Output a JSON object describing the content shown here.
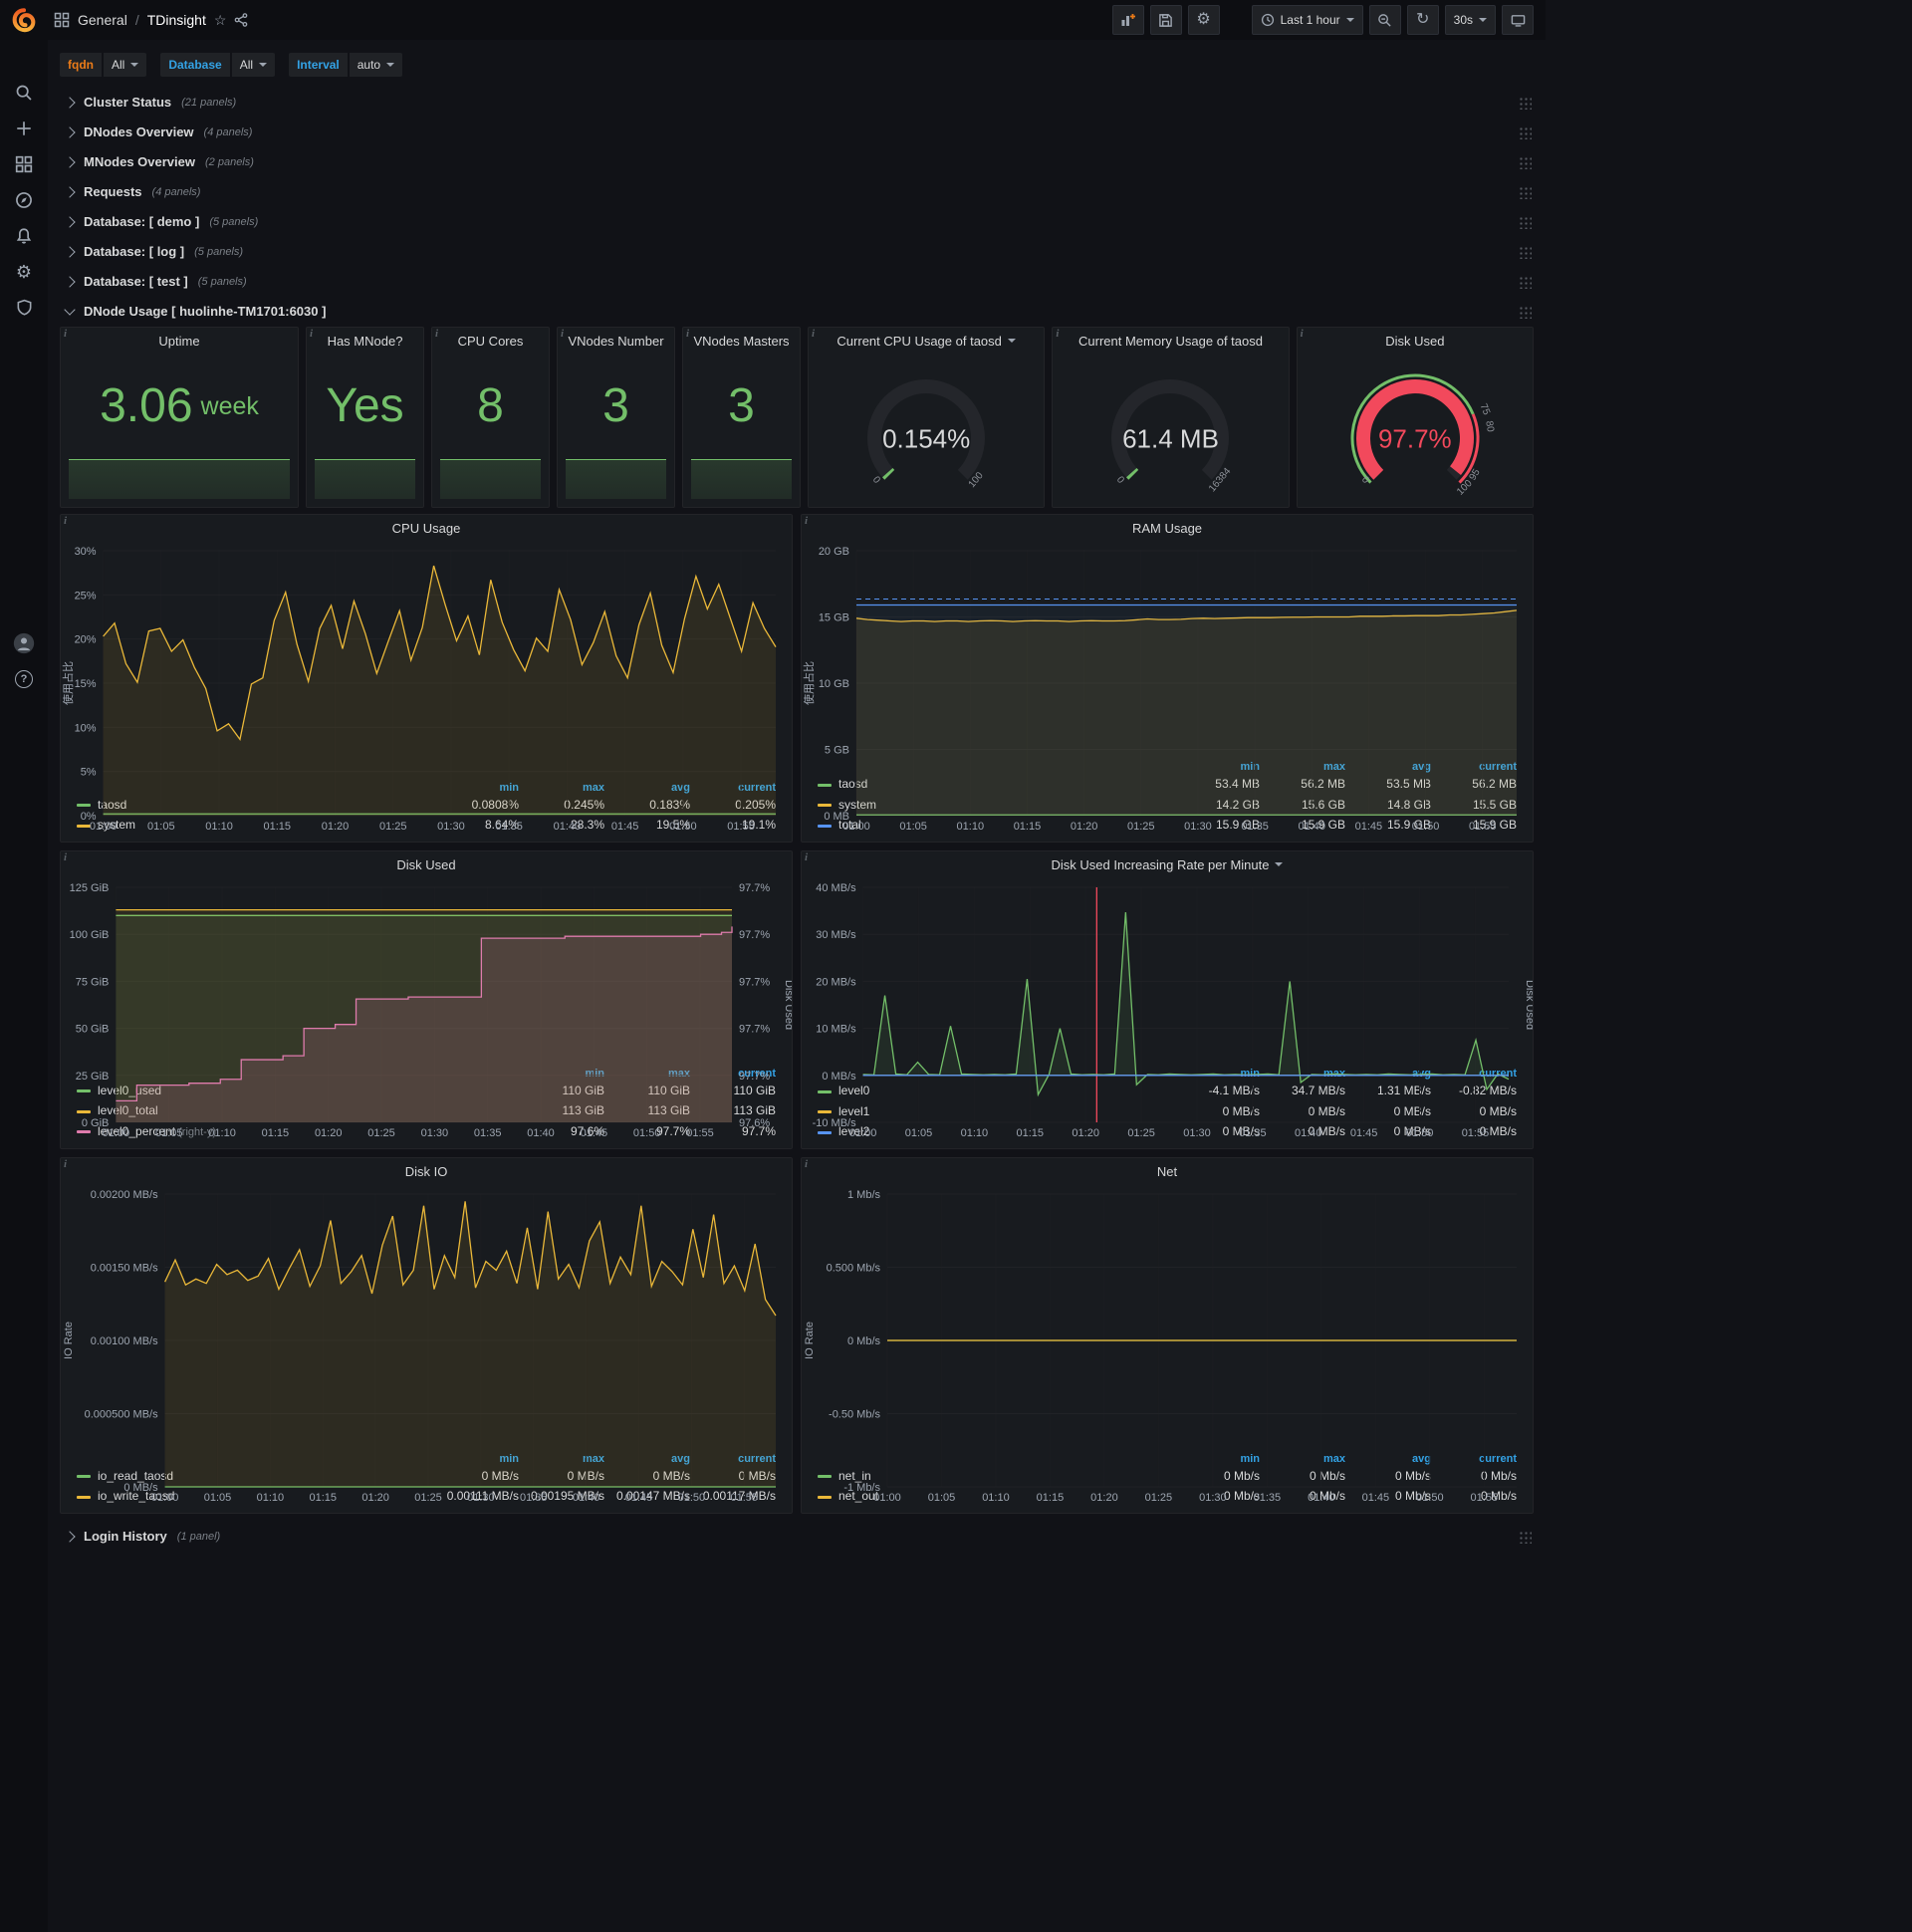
{
  "topnav": {
    "section": "General",
    "separator": "/",
    "page": "TDinsight",
    "time_range": "Last 1 hour",
    "refresh_interval": "30s"
  },
  "icons": {
    "gear": "⚙",
    "refresh": "↻",
    "star": "☆",
    "question": "?",
    "plus": "+"
  },
  "variables": [
    {
      "label": "fqdn",
      "value": "All",
      "label_color": "#eb7b18"
    },
    {
      "label": "Database",
      "value": "All",
      "label_color": "#33a2e5"
    },
    {
      "label": "Interval",
      "value": "auto",
      "label_color": "#33a2e5"
    }
  ],
  "collapsed_rows": [
    {
      "title": "Cluster Status",
      "count": "(21 panels)"
    },
    {
      "title": "DNodes Overview",
      "count": "(4 panels)"
    },
    {
      "title": "MNodes Overview",
      "count": "(2 panels)"
    },
    {
      "title": "Requests",
      "count": "(4 panels)"
    },
    {
      "title": "Database: [ demo ]",
      "count": "(5 panels)"
    },
    {
      "title": "Database: [ log ]",
      "count": "(5 panels)"
    },
    {
      "title": "Database: [ test ]",
      "count": "(5 panels)"
    }
  ],
  "expanded_row": {
    "title": "DNode Usage [ huolinhe-TM1701:6030 ]"
  },
  "bottom_row": {
    "title": "Login History",
    "count": "(1 panel)"
  },
  "stats": [
    {
      "title": "Uptime",
      "value": "3.06",
      "unit": "week"
    },
    {
      "title": "Has MNode?",
      "value": "Yes"
    },
    {
      "title": "CPU Cores",
      "value": "8"
    },
    {
      "title": "VNodes Number",
      "value": "3"
    },
    {
      "title": "VNodes Masters",
      "value": "3"
    }
  ],
  "gauges": [
    {
      "title": "Current CPU Usage of taosd",
      "value": "0.154%",
      "min": "0",
      "max": "100",
      "fraction": 0.00154,
      "arc_color": "#73bf69",
      "value_color": "#d8d9da",
      "has_dropdown": true
    },
    {
      "title": "Current Memory Usage of taosd",
      "value": "61.4 MB",
      "min": "0",
      "max": "16384",
      "fraction": 0.00375,
      "arc_color": "#73bf69",
      "value_color": "#d8d9da"
    },
    {
      "title": "Disk Used",
      "value": "97.7%",
      "min": "0",
      "max": "100",
      "fraction": 0.977,
      "arc_color": "#f2495c",
      "value_color": "#f2495c",
      "thresholds": [
        {
          "label": "75",
          "value": 75
        },
        {
          "label": "80",
          "value": 80
        },
        {
          "label": "95",
          "value": 95
        },
        {
          "label": "100",
          "value": 100
        }
      ],
      "ring": [
        {
          "from": 0,
          "to": 0.75,
          "color": "#73bf69"
        },
        {
          "from": 0.75,
          "to": 1,
          "color": "#f2495c"
        }
      ]
    }
  ],
  "time_ticks": [
    "01:00",
    "01:05",
    "01:10",
    "01:15",
    "01:20",
    "01:25",
    "01:30",
    "01:35",
    "01:40",
    "01:45",
    "01:50",
    "01:55"
  ],
  "charts": [
    {
      "type": "line",
      "title": "CPU Usage",
      "y_label": "使用占比",
      "y_ticks": [
        "30%",
        "25%",
        "20%",
        "15%",
        "10%",
        "5%",
        "0%"
      ],
      "ymin": 0,
      "ymax": 30,
      "legend_cols": [
        "min",
        "max",
        "avg",
        "current"
      ],
      "series": [
        {
          "name": "taosd",
          "color": "#73bf69",
          "flat": 0.2,
          "n": 60,
          "stats": [
            "0.0808%",
            "0.245%",
            "0.183%",
            "0.205%"
          ]
        },
        {
          "name": "system",
          "color": "#eab839",
          "values": [
            20.3,
            21.8,
            17.2,
            15.1,
            20.9,
            21.2,
            18.6,
            19.9,
            16.8,
            14.4,
            9.6,
            10.4,
            8.64,
            14.9,
            15.6,
            22.1,
            25.3,
            19.4,
            15.2,
            21.2,
            23.8,
            18.9,
            24.3,
            20.6,
            16.1,
            19.7,
            23.2,
            17.6,
            21.3,
            28.3,
            23.9,
            19.8,
            22.6,
            18.2,
            26.7,
            21.9,
            18.8,
            16.4,
            20.1,
            18.6,
            25.6,
            22.2,
            17.1,
            19.6,
            23.1,
            18.1,
            15.6,
            21.6,
            25.2,
            19.3,
            16.2,
            22.3,
            27.1,
            23.4,
            26.2,
            22.4,
            18.6,
            24.1,
            21.2,
            19.1
          ],
          "stats": [
            "8.64%",
            "28.3%",
            "19.5%",
            "19.1%"
          ]
        }
      ]
    },
    {
      "type": "line",
      "title": "RAM Usage",
      "y_label": "使用占比",
      "y_ticks": [
        "20 GB",
        "15 GB",
        "10 GB",
        "5 GB",
        "0 MB"
      ],
      "ymin": 0,
      "ymax": 20,
      "threshold": 16.35,
      "legend_cols": [
        "min",
        "max",
        "avg",
        "current"
      ],
      "series": [
        {
          "name": "taosd",
          "color": "#73bf69",
          "flat": 0.055,
          "n": 60,
          "stats": [
            "53.4 MB",
            "56.2 MB",
            "53.5 MB",
            "56.2 MB"
          ]
        },
        {
          "name": "system",
          "color": "#eab839",
          "values": [
            14.9,
            14.8,
            14.75,
            14.7,
            14.65,
            14.7,
            14.7,
            14.65,
            14.7,
            14.7,
            14.65,
            14.7,
            14.72,
            14.7,
            14.65,
            14.7,
            14.72,
            14.7,
            14.7,
            14.65,
            14.7,
            14.72,
            14.7,
            14.7,
            14.72,
            14.78,
            14.85,
            14.8,
            14.8,
            14.82,
            14.88,
            14.9,
            14.88,
            14.9,
            14.92,
            14.95,
            14.95,
            14.95,
            14.97,
            14.98,
            14.98,
            15.0,
            15.0,
            15.0,
            15.0,
            15.05,
            15.05,
            15.05,
            15.08,
            15.08,
            15.1,
            15.1,
            15.1,
            15.15,
            15.15,
            15.2,
            15.25,
            15.3,
            15.4,
            15.5
          ],
          "stats": [
            "14.2 GB",
            "15.6 GB",
            "14.8 GB",
            "15.5 GB"
          ]
        },
        {
          "name": "total",
          "color": "#5794f2",
          "flat": 15.9,
          "n": 60,
          "fill_opacity": 0.05,
          "stats": [
            "15.9 GB",
            "15.9 GB",
            "15.9 GB",
            "15.9 GB"
          ]
        }
      ]
    },
    {
      "type": "line",
      "title": "Disk Used",
      "y_ticks": [
        "125 GiB",
        "100 GiB",
        "75 GiB",
        "50 GiB",
        "25 GiB",
        "0 GiB"
      ],
      "ymin": 0,
      "ymax": 125,
      "right_ticks": [
        "97.7%",
        "97.7%",
        "97.7%",
        "97.7%",
        "97.7%",
        "97.6%"
      ],
      "right_range": [
        97.6,
        97.72
      ],
      "right_label": "Disk Used",
      "legend_cols": [
        "min",
        "max",
        "current"
      ],
      "series": [
        {
          "name": "level0_used",
          "color": "#73bf69",
          "flat": 110,
          "n": 60,
          "stats": [
            "110 GiB",
            "110 GiB",
            "110 GiB"
          ]
        },
        {
          "name": "level0_total",
          "color": "#eab839",
          "flat": 113,
          "n": 60,
          "stats": [
            "113 GiB",
            "113 GiB",
            "113 GiB"
          ]
        },
        {
          "name": "level0_percent",
          "suffix": "(right-y)",
          "color": "#de7bac",
          "right_axis": true,
          "step": true,
          "fill_opacity": 0.16,
          "values": [
            97.611,
            97.611,
            97.619,
            97.619,
            97.619,
            97.619,
            97.619,
            97.62,
            97.62,
            97.62,
            97.622,
            97.622,
            97.632,
            97.632,
            97.632,
            97.632,
            97.634,
            97.634,
            97.648,
            97.648,
            97.648,
            97.65,
            97.65,
            97.663,
            97.663,
            97.663,
            97.663,
            97.663,
            97.664,
            97.664,
            97.664,
            97.664,
            97.664,
            97.664,
            97.664,
            97.694,
            97.694,
            97.694,
            97.694,
            97.694,
            97.694,
            97.694,
            97.694,
            97.695,
            97.695,
            97.695,
            97.695,
            97.695,
            97.695,
            97.695,
            97.695,
            97.695,
            97.695,
            97.695,
            97.695,
            97.695,
            97.696,
            97.696,
            97.697,
            97.7
          ],
          "stats": [
            "97.6%",
            "97.7%",
            "97.7%"
          ]
        }
      ]
    },
    {
      "type": "line",
      "title": "Disk Used Increasing Rate per Minute",
      "has_dropdown": true,
      "y_ticks": [
        "40 MB/s",
        "30 MB/s",
        "20 MB/s",
        "10 MB/s",
        "0 MB/s",
        "-10 MB/s"
      ],
      "ymin": -10,
      "ymax": 40,
      "right_label": "Disk Used",
      "annotation_x": 0.362,
      "legend_cols": [
        "min",
        "max",
        "avg",
        "current"
      ],
      "series": [
        {
          "name": "level0",
          "color": "#73bf69",
          "values": [
            0.2,
            0.1,
            17,
            0.3,
            0.1,
            2.8,
            0.2,
            0.1,
            10.5,
            0.3,
            0.2,
            0.1,
            0.2,
            0.1,
            0.3,
            20.5,
            -4.1,
            0.2,
            10,
            0.3,
            0.1,
            0.2,
            0.1,
            0.3,
            34.7,
            -2,
            0.2,
            0.1,
            0.3,
            0.2,
            0.1,
            0.2,
            0.3,
            0.1,
            0.2,
            0.1,
            0.2,
            0.3,
            0.1,
            20,
            -1.5,
            0.2,
            0.1,
            0.3,
            0.2,
            0.1,
            0.2,
            0.1,
            0.3,
            0.2,
            0.1,
            0.2,
            0.3,
            0.1,
            0.2,
            0.1,
            7.5,
            -3,
            0.3,
            -0.82
          ],
          "stats": [
            "-4.1 MB/s",
            "34.7 MB/s",
            "1.31 MB/s",
            "-0.82 MB/s"
          ]
        },
        {
          "name": "level1",
          "color": "#eab839",
          "flat": 0,
          "n": 60,
          "stats": [
            "0 MB/s",
            "0 MB/s",
            "0 MB/s",
            "0 MB/s"
          ]
        },
        {
          "name": "level2",
          "color": "#5794f2",
          "flat": 0,
          "n": 60,
          "stats": [
            "0 MB/s",
            "0 MB/s",
            "0 MB/s",
            "0 MB/s"
          ]
        }
      ]
    },
    {
      "type": "line",
      "title": "Disk IO",
      "y_label": "IO Rate",
      "y_ticks": [
        "0.00200 MB/s",
        "0.00150 MB/s",
        "0.00100 MB/s",
        "0.000500 MB/s",
        "0 MB/s"
      ],
      "ymin": 0,
      "ymax": 0.002,
      "legend_cols": [
        "min",
        "max",
        "avg",
        "current"
      ],
      "series": [
        {
          "name": "io_read_taosd",
          "color": "#73bf69",
          "flat": 0,
          "n": 60,
          "stats": [
            "0 MB/s",
            "0 MB/s",
            "0 MB/s",
            "0 MB/s"
          ]
        },
        {
          "name": "io_write_taosd",
          "color": "#eab839",
          "values": [
            0.0014,
            0.00155,
            0.00138,
            0.00142,
            0.00139,
            0.00152,
            0.00145,
            0.00148,
            0.00141,
            0.00144,
            0.00156,
            0.00135,
            0.00149,
            0.00162,
            0.00137,
            0.00151,
            0.00182,
            0.00139,
            0.00147,
            0.00158,
            0.00132,
            0.00165,
            0.00185,
            0.00138,
            0.00148,
            0.00192,
            0.00135,
            0.00158,
            0.00143,
            0.00195,
            0.00136,
            0.00154,
            0.00148,
            0.00161,
            0.00139,
            0.00177,
            0.00135,
            0.00188,
            0.00142,
            0.00152,
            0.00136,
            0.00168,
            0.00181,
            0.00139,
            0.00157,
            0.00145,
            0.00192,
            0.00137,
            0.00154,
            0.00147,
            0.00138,
            0.00176,
            0.00143,
            0.00186,
            0.00139,
            0.00151,
            0.00134,
            0.00166,
            0.00128,
            0.00117
          ],
          "stats": [
            "0.00111 MB/s",
            "0.00195 MB/s",
            "0.00147 MB/s",
            "0.00117 MB/s"
          ]
        }
      ]
    },
    {
      "type": "line",
      "title": "Net",
      "y_label": "IO Rate",
      "y_ticks": [
        "1 Mb/s",
        "0.500 Mb/s",
        "0 Mb/s",
        "-0.50 Mb/s",
        "-1 Mb/s"
      ],
      "ymin": -1,
      "ymax": 1,
      "legend_cols": [
        "min",
        "max",
        "avg",
        "current"
      ],
      "series": [
        {
          "name": "net_in",
          "color": "#73bf69",
          "flat": 0,
          "n": 60,
          "stats": [
            "0 Mb/s",
            "0 Mb/s",
            "0 Mb/s",
            "0 Mb/s"
          ]
        },
        {
          "name": "net_out",
          "color": "#eab839",
          "flat": 0,
          "n": 60,
          "stats": [
            "0 Mb/s",
            "0 Mb/s",
            "0 Mb/s",
            "0 Mb/s"
          ]
        }
      ]
    }
  ]
}
